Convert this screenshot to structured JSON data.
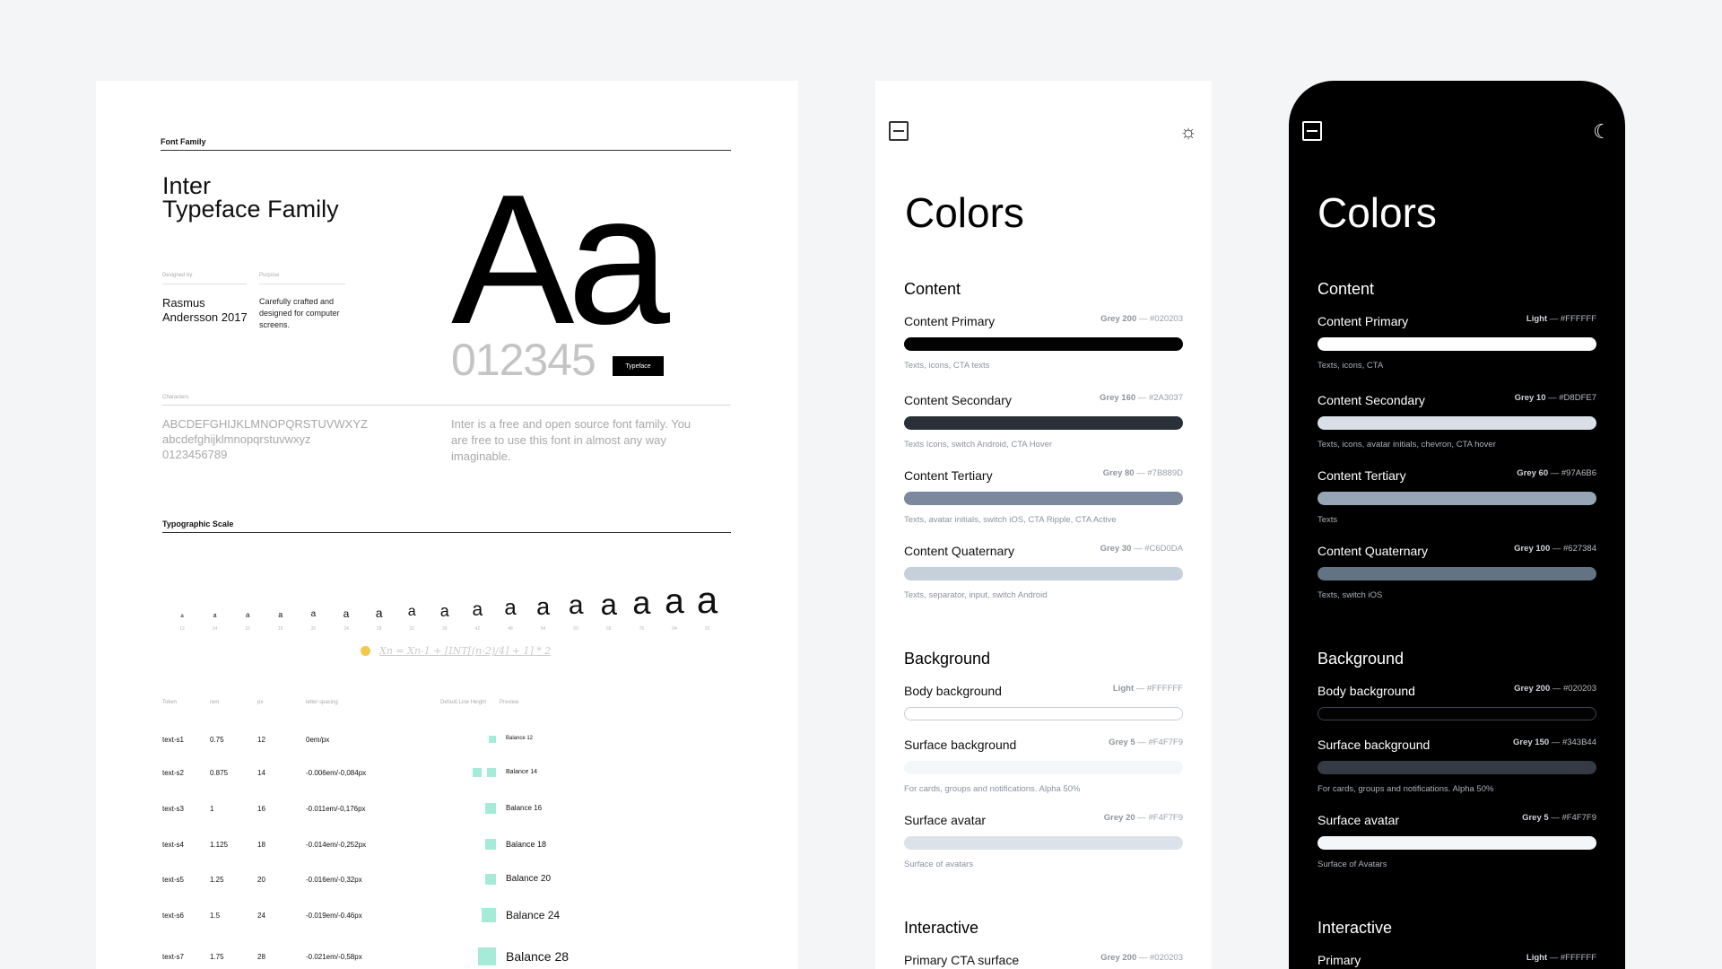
{
  "typography": {
    "font_family_label": "Font Family",
    "title_line1": "Inter",
    "title_line2": "Typeface Family",
    "designed_by_label": "Designed by",
    "purpose_label": "Purpose",
    "designer": "Rasmus Andersson 2017",
    "purpose": "Carefully crafted and designed for computer screens.",
    "specimen": "Aa",
    "numbers": "012345",
    "typeface_button": "Typeface",
    "characters_label": "Characters",
    "uppercase": "ABCDEFGHIJKLMNOPQRSTUVWXYZ",
    "lowercase": "abcdefghijklmnopqrstuvwxyz",
    "digits": "0123456789",
    "description": "Inter is a free and open source font family. You are free to use this font in almost any way imaginable.",
    "scale_label": "Typographic Scale",
    "scale_glyph": "a",
    "scale_sizes": [
      "12",
      "14",
      "16",
      "18",
      "20",
      "24",
      "28",
      "32",
      "36",
      "42",
      "48",
      "54",
      "60",
      "68",
      "76",
      "84",
      "92"
    ],
    "formula": "Xn = Xn-1 + [INT[(n-2)/4] + 1] * 2",
    "table_headers": {
      "token": "Token",
      "rem": "rem",
      "px": "px",
      "spacing": "letter spacing",
      "lineheight": "Default Line Height",
      "preview": "Preview"
    },
    "rows": [
      {
        "token": "text-s1",
        "rem": "0.75",
        "px": "12",
        "spacing": "0em/px",
        "preview": "Balance 12"
      },
      {
        "token": "text-s2",
        "rem": "0.875",
        "px": "14",
        "spacing": "-0.006em/-0,084px",
        "preview": "Balance 14"
      },
      {
        "token": "text-s3",
        "rem": "1",
        "px": "16",
        "spacing": "-0.011em/-0,176px",
        "preview": "Balance 16"
      },
      {
        "token": "text-s4",
        "rem": "1.125",
        "px": "18",
        "spacing": "-0.014em/-0,252px",
        "preview": "Balance 18"
      },
      {
        "token": "text-s5",
        "rem": "1.25",
        "px": "20",
        "spacing": "-0.016em/-0,32px",
        "preview": "Balance 20"
      },
      {
        "token": "text-s6",
        "rem": "1.5",
        "px": "24",
        "spacing": "-0.019em/-0.46px",
        "preview": "Balance 24"
      },
      {
        "token": "text-s7",
        "rem": "1.75",
        "px": "28",
        "spacing": "-0.021em/-0,58px",
        "preview": "Balance 28"
      }
    ]
  },
  "light": {
    "title": "Colors",
    "content_label": "Content",
    "background_label": "Background",
    "interactive_label": "Interactive",
    "content": [
      {
        "name": "Content Primary",
        "grey": "Grey 200",
        "hex": " — #020203",
        "color": "#020203",
        "desc": "Texts, icons, CTA texts"
      },
      {
        "name": "Content Secondary",
        "grey": "Grey 160",
        "hex": " — #2A3037",
        "color": "#2A3037",
        "desc": "Texts Icons, switch Android, CTA Hover"
      },
      {
        "name": "Content Tertiary",
        "grey": "Grey 80",
        "hex": " — #7B889D",
        "color": "#7B889D",
        "desc": "Texts, avatar initials, switch iOS, CTA Ripple, CTA Active"
      },
      {
        "name": "Content Quaternary",
        "grey": "Grey 30",
        "hex": " — #C6D0DA",
        "color": "#C6D0DA",
        "desc": "Texts, separator, input, switch Android"
      }
    ],
    "background": [
      {
        "name": "Body background",
        "grey": "Light",
        "hex": " — #FFFFFF",
        "color": "#FFFFFF",
        "desc": ""
      },
      {
        "name": "Surface background",
        "grey": "Grey 5",
        "hex": " — #F4F7F9",
        "color": "#F4F7F9",
        "desc": "For cards, groups and notifications. Alpha 50%"
      },
      {
        "name": "Surface avatar",
        "grey": "Grey 20",
        "hex": " — #F4F7F9",
        "color": "#DCE2EA",
        "desc": "Surface of avatars"
      }
    ],
    "interactive": [
      {
        "name": "Primary CTA surface",
        "grey": "Grey 200",
        "hex": " — #020203"
      }
    ]
  },
  "dark": {
    "title": "Colors",
    "content_label": "Content",
    "background_label": "Background",
    "interactive_label": "Interactive",
    "content": [
      {
        "name": "Content Primary",
        "grey": "Light",
        "hex": " — #FFFFFF",
        "color": "#FFFFFF",
        "desc": "Texts, icons, CTA"
      },
      {
        "name": "Content Secondary",
        "grey": "Grey 10",
        "hex": " — #D8DFE7",
        "color": "#D8DFE7",
        "desc": "Texts, icons, avatar initials, chevron, CTA hover"
      },
      {
        "name": "Content Tertiary",
        "grey": "Grey 60",
        "hex": " — #97A6B6",
        "color": "#97A6B6",
        "desc": "Texts"
      },
      {
        "name": "Content Quaternary",
        "grey": "Grey 100",
        "hex": " — #627384",
        "color": "#627384",
        "desc": "Texts, switch iOS"
      }
    ],
    "background": [
      {
        "name": "Body background",
        "grey": "Grey 200",
        "hex": " — #020203",
        "color": "#020203",
        "desc": ""
      },
      {
        "name": "Surface background",
        "grey": "Grey 150",
        "hex": " — #343B44",
        "color": "#343B44",
        "desc": "For cards, groups and notifications. Alpha 50%"
      },
      {
        "name": "Surface avatar",
        "grey": "Grey 5",
        "hex": " — #F4F7F9",
        "color": "#F4F7F9",
        "desc": "Surface of Avatars"
      }
    ],
    "interactive": [
      {
        "name": "Primary",
        "grey": "Light",
        "hex": " — #FFFFFF"
      }
    ]
  }
}
